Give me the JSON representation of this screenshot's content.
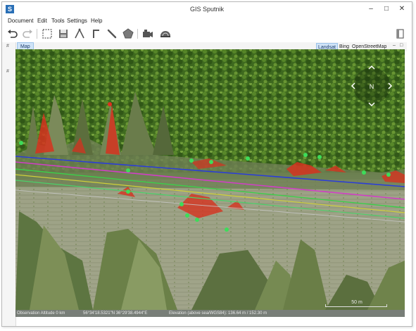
{
  "window": {
    "title": "GIS Sputnik",
    "app_icon": "S"
  },
  "window_controls": {
    "minimize": "–",
    "maximize": "□",
    "close": "✕"
  },
  "menu": [
    "Document",
    "Edit",
    "Tools",
    "Settings",
    "Help"
  ],
  "toolbar_icons": [
    "undo-icon",
    "redo-icon",
    "select-rectangle-icon",
    "save-icon",
    "draw-line-icon",
    "draw-polyline-icon",
    "draw-path-icon",
    "draw-polygon-icon",
    "camera-icon",
    "dome-icon",
    "panel-toggle-icon"
  ],
  "side_pins": [
    "#",
    "#"
  ],
  "tabs": {
    "map_label": "Map"
  },
  "layers": {
    "landsat": "Landsat",
    "bing": "Bing",
    "osm": "OpenStreetMap",
    "active": "Landsat"
  },
  "tab_controls": {
    "minimize": "–",
    "maximize": "□"
  },
  "compass": {
    "north_label": "N"
  },
  "scale": {
    "label": "50 m"
  },
  "status": {
    "altitude": "Observation Altitude 0 km",
    "coordinates": "56°34'18.5321\"N 36°29'38.4944\"E",
    "elevation": "Elevation (above sea/WGS84): 136.64 m / 152.30 m"
  },
  "colors": {
    "accent": "#2a6fb6",
    "tab_active": "#cfe3f7",
    "feature_red": "#e0301e",
    "point_green": "#3ddc5a"
  }
}
